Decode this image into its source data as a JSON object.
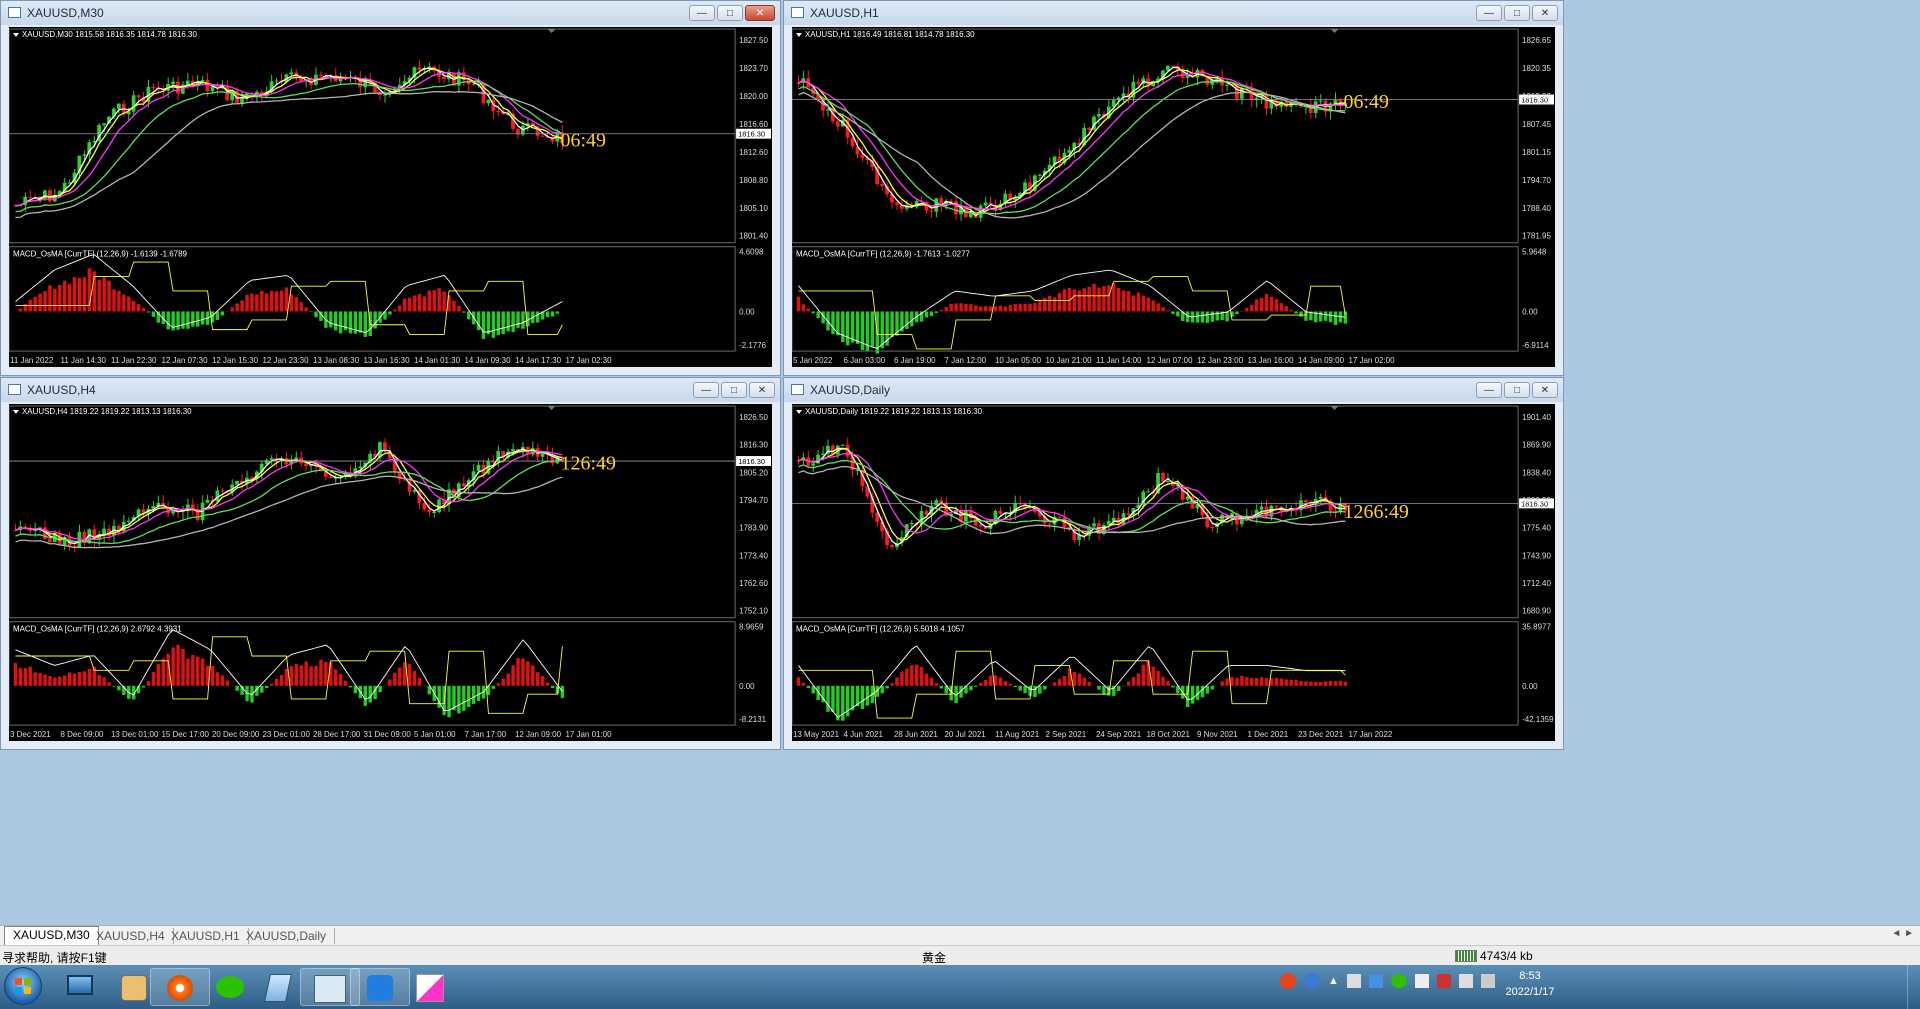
{
  "windows": [
    {
      "id": "m30",
      "title": "XAUUSD,M30",
      "chart_label": "XAUUSD,M30  1815.58 1816.35 1814.78 1816.30",
      "countdown": "06:49",
      "macd_label": "MACD_OsMA [CurrTF] (12,26,9) -1.6139 -1.6789",
      "price_ticks": [
        "1827.50",
        "1823.70",
        "1820.00",
        "1816.60",
        "1812.60",
        "1808.80",
        "1805.10",
        "1801.40"
      ],
      "current_price": "1816.30",
      "macd_ticks": [
        "4.6098",
        "0.00",
        "-2.1776"
      ],
      "time_ticks": [
        "11 Jan 2022",
        "11 Jan 14:30",
        "11 Jan 22:30",
        "12 Jan 07:30",
        "12 Jan 15:30",
        "12 Jan 23:30",
        "13 Jan 08:30",
        "13 Jan 16:30",
        "14 Jan 01:30",
        "14 Jan 09:30",
        "14 Jan 17:30",
        "17 Jan 02:30"
      ]
    },
    {
      "id": "h1",
      "title": "XAUUSD,H1",
      "chart_label": "XAUUSD,H1  1816.49 1816.81 1814.78 1816.30",
      "countdown": "06:49",
      "macd_label": "MACD_OsMA [CurrTF] (12,26,9) -1.7613 -1.0277",
      "price_ticks": [
        "1826.65",
        "1820.35",
        "1813.90",
        "1807.45",
        "1801.15",
        "1794.70",
        "1788.40",
        "1781.95"
      ],
      "current_price": "1816.30",
      "macd_ticks": [
        "5.9648",
        "0.00",
        "-6.9114"
      ],
      "time_ticks": [
        "5 Jan 2022",
        "6 Jan 03:00",
        "6 Jan 19:00",
        "7 Jan 12:00",
        "10 Jan 05:00",
        "10 Jan 21:00",
        "11 Jan 14:00",
        "12 Jan 07:00",
        "12 Jan 23:00",
        "13 Jan 16:00",
        "14 Jan 09:00",
        "17 Jan 02:00"
      ]
    },
    {
      "id": "h4",
      "title": "XAUUSD,H4",
      "chart_label": "XAUUSD,H4  1819.22 1819.22 1813.13 1816.30",
      "countdown": "126:49",
      "macd_label": "MACD_OsMA [CurrTF] (12,26,9) 2.6792 4.3931",
      "price_ticks": [
        "1826.50",
        "1816.30",
        "1805.20",
        "1794.70",
        "1783.90",
        "1773.40",
        "1762.60",
        "1752.10"
      ],
      "current_price": "1816.30",
      "macd_ticks": [
        "8.9659",
        "0.00",
        "-8.2131"
      ],
      "time_ticks": [
        "3 Dec 2021",
        "8 Dec 09:00",
        "13 Dec 01:00",
        "15 Dec 17:00",
        "20 Dec 09:00",
        "23 Dec 01:00",
        "28 Dec 17:00",
        "31 Dec 09:00",
        "5 Jan 01:00",
        "7 Jan 17:00",
        "12 Jan 09:00",
        "17 Jan 01:00"
      ]
    },
    {
      "id": "daily",
      "title": "XAUUSD,Daily",
      "chart_label": "XAUUSD,Daily  1819.22 1819.22 1813.13 1816.30",
      "countdown": "1266:49",
      "macd_label": "MACD_OsMA [CurrTF] (12,26,9) 5.5018 4.1057",
      "price_ticks": [
        "1901.40",
        "1869.90",
        "1838.40",
        "1806.90",
        "1775.40",
        "1743.90",
        "1712.40",
        "1680.90"
      ],
      "current_price": "1816.30",
      "macd_ticks": [
        "35.8977",
        "0.00",
        "-42.1359"
      ],
      "time_ticks": [
        "13 May 2021",
        "4 Jun 2021",
        "28 Jun 2021",
        "20 Jul 2021",
        "11 Aug 2021",
        "2 Sep 2021",
        "24 Sep 2021",
        "18 Oct 2021",
        "9 Nov 2021",
        "1 Dec 2021",
        "23 Dec 2021",
        "17 Jan 2022"
      ]
    }
  ],
  "tabs": [
    "XAUUSD,M30",
    "XAUUSD,H4",
    "XAUUSD,H1",
    "XAUUSD,Daily"
  ],
  "status": {
    "help": "寻求帮助, 请按F1键",
    "symbol": "黄金",
    "traffic": "4743/4 kb"
  },
  "clock": {
    "time": "8:53",
    "date": "2022/1/17"
  },
  "colors": {
    "bull": "#2ed12e",
    "bear": "#ff1a1a",
    "ma_white": "#ffffff",
    "ma_yellow": "#ffff3c",
    "ma_magenta": "#ff33ff",
    "ma_green": "#5de05d",
    "ma_gray": "#b4b4b4",
    "countdown": "#ffd12a",
    "hist_up": "#e01010",
    "hist_dn": "#22cc22"
  }
}
